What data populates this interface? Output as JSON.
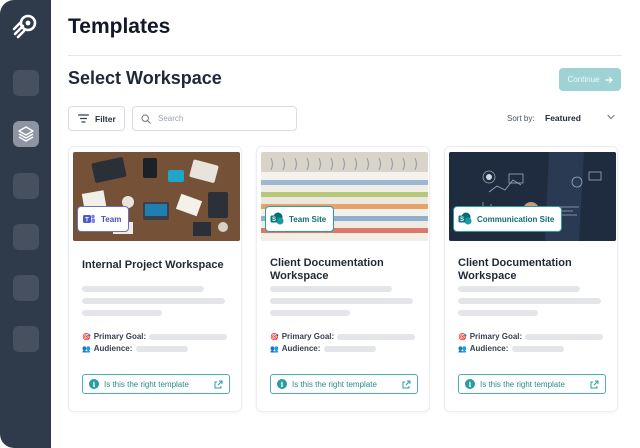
{
  "page": {
    "title": "Templates"
  },
  "workspace": {
    "heading": "Select Workspace",
    "continue_label": "Continue"
  },
  "toolbar": {
    "filter_label": "Filter",
    "search_placeholder": "Search",
    "sort_label": "Sort by:",
    "sort_value": "Featured"
  },
  "colors": {
    "sidebar": "#2f3a4b",
    "accent": "#2a9d9f",
    "continue_disabled": "#9fd2d5"
  },
  "cards": [
    {
      "badge": "Team",
      "badge_icon": "teams-icon",
      "title": "Internal Project Workspace",
      "goal_label": "Primary Goal:",
      "audience_label": "Audience:",
      "check_label": "Is this the right template"
    },
    {
      "badge": "Team Site",
      "badge_icon": "sharepoint-icon",
      "title": "Client Documentation Workspace",
      "goal_label": "Primary Goal:",
      "audience_label": "Audience:",
      "check_label": "Is this the right template"
    },
    {
      "badge": "Communication Site",
      "badge_icon": "sharepoint-icon",
      "title": "Client Documentation Workspace",
      "goal_label": "Primary Goal:",
      "audience_label": "Audience:",
      "check_label": "Is this the right template"
    }
  ]
}
